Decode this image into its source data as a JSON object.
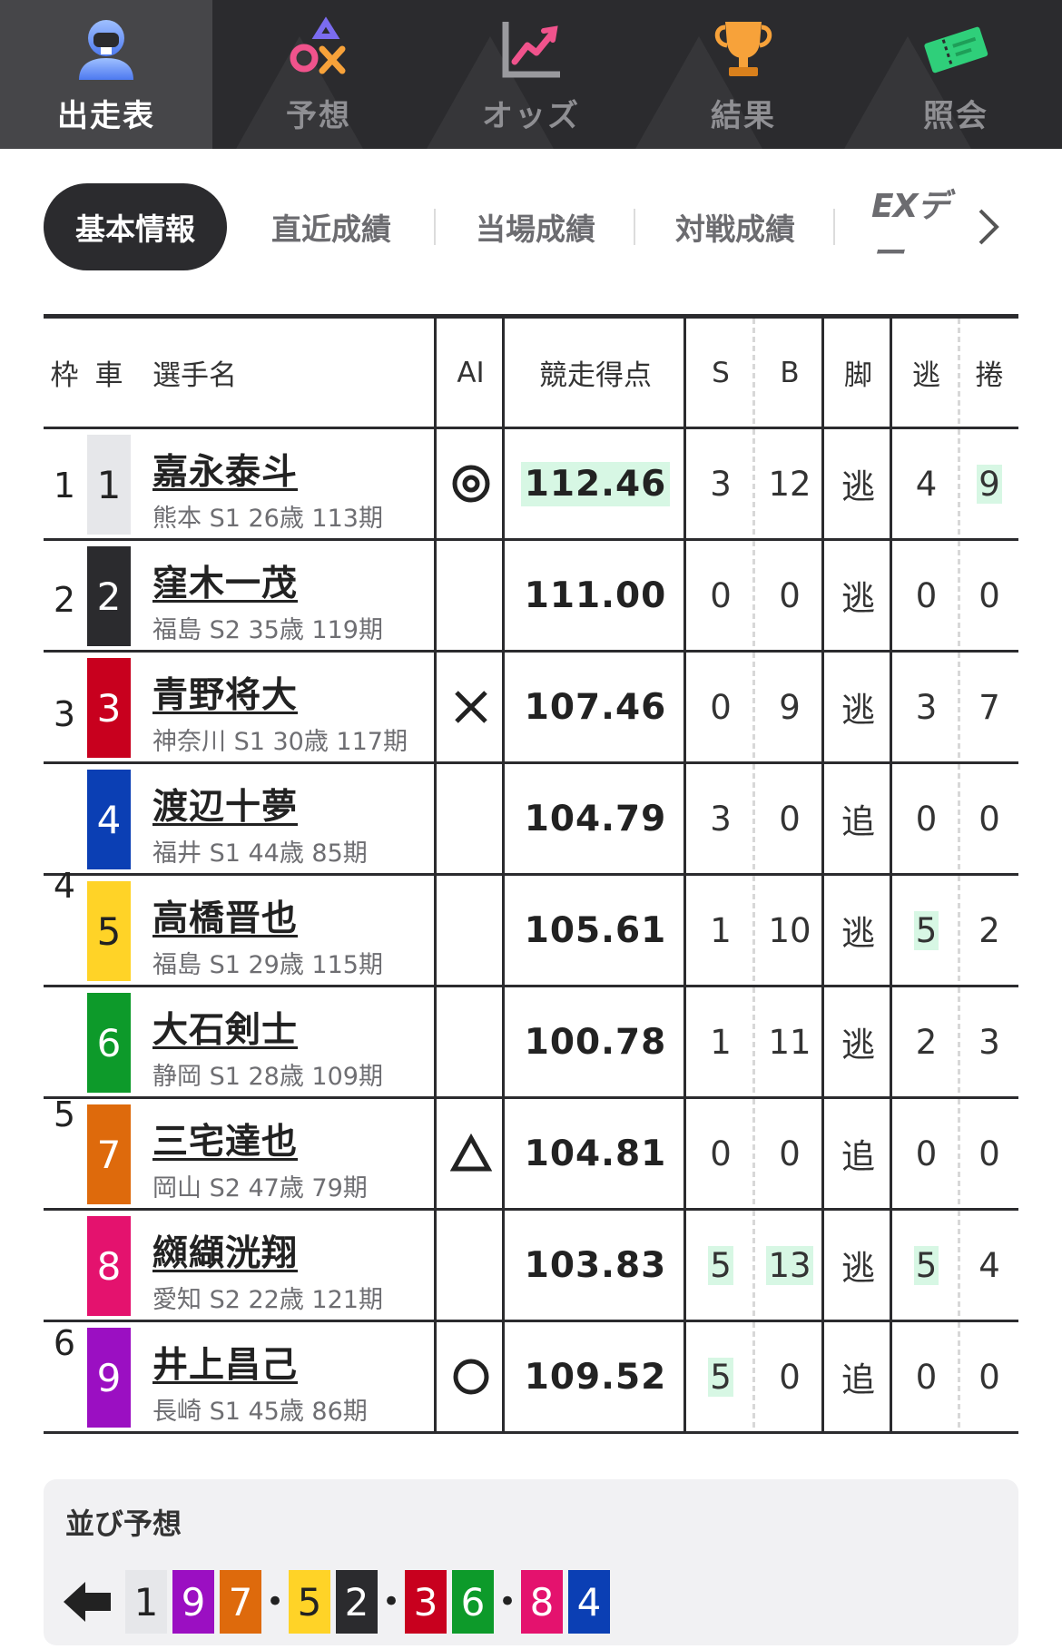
{
  "nav": {
    "items": [
      {
        "label": "出走表",
        "icon": "person-icon",
        "active": true
      },
      {
        "label": "予想",
        "icon": "symbols-icon",
        "active": false
      },
      {
        "label": "オッズ",
        "icon": "chart-icon",
        "active": false
      },
      {
        "label": "結果",
        "icon": "trophy-icon",
        "active": false
      },
      {
        "label": "照会",
        "icon": "ticket-icon",
        "active": false
      }
    ]
  },
  "subtabs": {
    "items": [
      "基本情報",
      "直近成績",
      "当場成績",
      "対戦成績",
      "EXデー"
    ],
    "active": 0
  },
  "table": {
    "headers": {
      "waku": "枠",
      "car": "車",
      "name": "選手名",
      "ai": "AI",
      "score": "競走得点",
      "s": "S",
      "b": "B",
      "leg": "脚",
      "nige": "逃",
      "makuri": "捲"
    },
    "waku_labels": [
      "1",
      "2",
      "3",
      "4",
      "5",
      "6"
    ],
    "rows": [
      {
        "waku": "1",
        "car": "1",
        "name": "嘉永泰斗",
        "info": "熊本 S1 26歳 113期",
        "ai": "◎",
        "score": "112.46",
        "s": "3",
        "b": "12",
        "leg": "逃",
        "nige": "4",
        "makuri": "9"
      },
      {
        "waku": "2",
        "car": "2",
        "name": "窪木一茂",
        "info": "福島 S2 35歳 119期",
        "ai": "",
        "score": "111.00",
        "s": "0",
        "b": "0",
        "leg": "逃",
        "nige": "0",
        "makuri": "0"
      },
      {
        "waku": "3",
        "car": "3",
        "name": "青野将大",
        "info": "神奈川 S1 30歳 117期",
        "ai": "×",
        "score": "107.46",
        "s": "0",
        "b": "9",
        "leg": "逃",
        "nige": "3",
        "makuri": "7"
      },
      {
        "waku": "4",
        "car": "4",
        "name": "渡辺十夢",
        "info": "福井 S1 44歳 85期",
        "ai": "",
        "score": "104.79",
        "s": "3",
        "b": "0",
        "leg": "追",
        "nige": "0",
        "makuri": "0"
      },
      {
        "waku": "4",
        "car": "5",
        "name": "高橋晋也",
        "info": "福島 S1 29歳 115期",
        "ai": "",
        "score": "105.61",
        "s": "1",
        "b": "10",
        "leg": "逃",
        "nige": "5",
        "makuri": "2"
      },
      {
        "waku": "5",
        "car": "6",
        "name": "大石剣士",
        "info": "静岡 S1 28歳 109期",
        "ai": "",
        "score": "100.78",
        "s": "1",
        "b": "11",
        "leg": "逃",
        "nige": "2",
        "makuri": "3"
      },
      {
        "waku": "5",
        "car": "7",
        "name": "三宅達也",
        "info": "岡山 S2 47歳 79期",
        "ai": "△",
        "score": "104.81",
        "s": "0",
        "b": "0",
        "leg": "追",
        "nige": "0",
        "makuri": "0"
      },
      {
        "waku": "6",
        "car": "8",
        "name": "纐纈洸翔",
        "info": "愛知 S2 22歳 121期",
        "ai": "",
        "score": "103.83",
        "s": "5",
        "b": "13",
        "leg": "逃",
        "nige": "5",
        "makuri": "4"
      },
      {
        "waku": "6",
        "car": "9",
        "name": "井上昌己",
        "info": "長崎 S1 45歳 86期",
        "ai": "○",
        "score": "109.52",
        "s": "5",
        "b": "0",
        "leg": "追",
        "nige": "0",
        "makuri": "0"
      }
    ]
  },
  "car_colors": {
    "1": {
      "bg": "#e6e7ea",
      "fg": "#222222"
    },
    "2": {
      "bg": "#2b2b2e",
      "fg": "#ffffff"
    },
    "3": {
      "bg": "#c8001e",
      "fg": "#ffffff"
    },
    "4": {
      "bg": "#0b3fb4",
      "fg": "#ffffff"
    },
    "5": {
      "bg": "#ffd327",
      "fg": "#222222"
    },
    "6": {
      "bg": "#0d9a2a",
      "fg": "#ffffff"
    },
    "7": {
      "bg": "#de6a0c",
      "fg": "#ffffff"
    },
    "8": {
      "bg": "#e4126e",
      "fg": "#ffffff"
    },
    "9": {
      "bg": "#9b0fc2",
      "fg": "#ffffff"
    }
  },
  "highlight_color": "#d7f7e4",
  "line_prediction": {
    "title": "並び予想",
    "groups": [
      [
        "1",
        "9",
        "7"
      ],
      [
        "5",
        "2"
      ],
      [
        "3",
        "6"
      ],
      [
        "8",
        "4"
      ]
    ]
  }
}
